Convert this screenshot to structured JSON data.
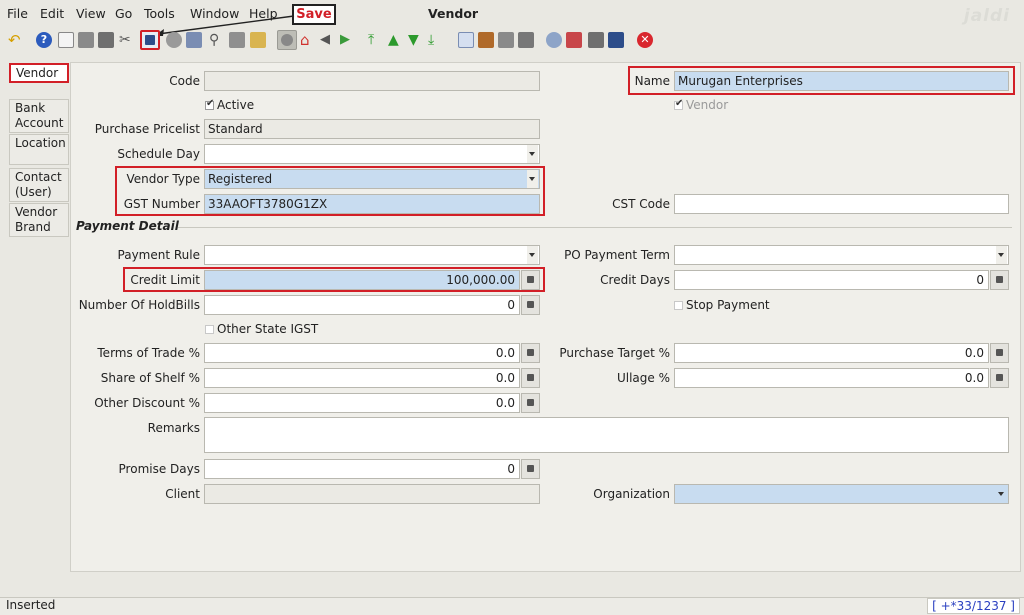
{
  "menu": [
    {
      "label": "File",
      "key": "F"
    },
    {
      "label": "Edit",
      "key": "E"
    },
    {
      "label": "View",
      "key": "V"
    },
    {
      "label": "Go",
      "key": "G"
    },
    {
      "label": "Tools",
      "key": "T"
    },
    {
      "label": "Window"
    },
    {
      "label": "Help"
    }
  ],
  "window_title": "Vendor",
  "logo_text": "jaldi",
  "save_callout": "Save",
  "tabs": [
    "Vendor",
    "Bank Account",
    "Location",
    "Contact (User)",
    "Vendor Brand"
  ],
  "fields": {
    "code_label": "Code",
    "code_value": "",
    "name_label": "Name",
    "name_value": "Murugan Enterprises",
    "active_label": "Active",
    "vendor_check_label": "Vendor",
    "pricelist_label": "Purchase Pricelist",
    "pricelist_value": "Standard",
    "schedule_day_label": "Schedule Day",
    "schedule_day_value": "",
    "vendor_type_label": "Vendor Type",
    "vendor_type_value": "Registered",
    "gst_number_label": "GST Number",
    "gst_number_value": "33AAOFT3780G1ZX",
    "cst_code_label": "CST Code",
    "cst_code_value": ""
  },
  "section_payment": "Payment Detail",
  "payment": {
    "payment_rule_label": "Payment Rule",
    "po_term_label": "PO Payment Term",
    "credit_limit_label": "Credit Limit",
    "credit_limit_value": "100,000.00",
    "credit_days_label": "Credit Days",
    "credit_days_value": "0",
    "holdbills_label": "Number Of HoldBills",
    "holdbills_value": "0",
    "stop_payment_label": "Stop Payment",
    "other_state_igst_label": "Other State IGST",
    "terms_trade_label": "Terms of Trade %",
    "terms_trade_value": "0.0",
    "purchase_target_label": "Purchase Target %",
    "purchase_target_value": "0.0",
    "share_shelf_label": "Share of Shelf %",
    "share_shelf_value": "0.0",
    "ullage_label": "Ullage %",
    "ullage_value": "0.0",
    "other_discount_label": "Other Discount %",
    "other_discount_value": "0.0",
    "remarks_label": "Remarks",
    "remarks_value": "",
    "promise_days_label": "Promise Days",
    "promise_days_value": "0",
    "client_label": "Client",
    "organization_label": "Organization"
  },
  "status": {
    "text": "Inserted",
    "record": "[ +*33/1237 ]"
  },
  "colors": {
    "highlight_box": "#d21f27",
    "field_highlight": "#c8dcf0"
  }
}
